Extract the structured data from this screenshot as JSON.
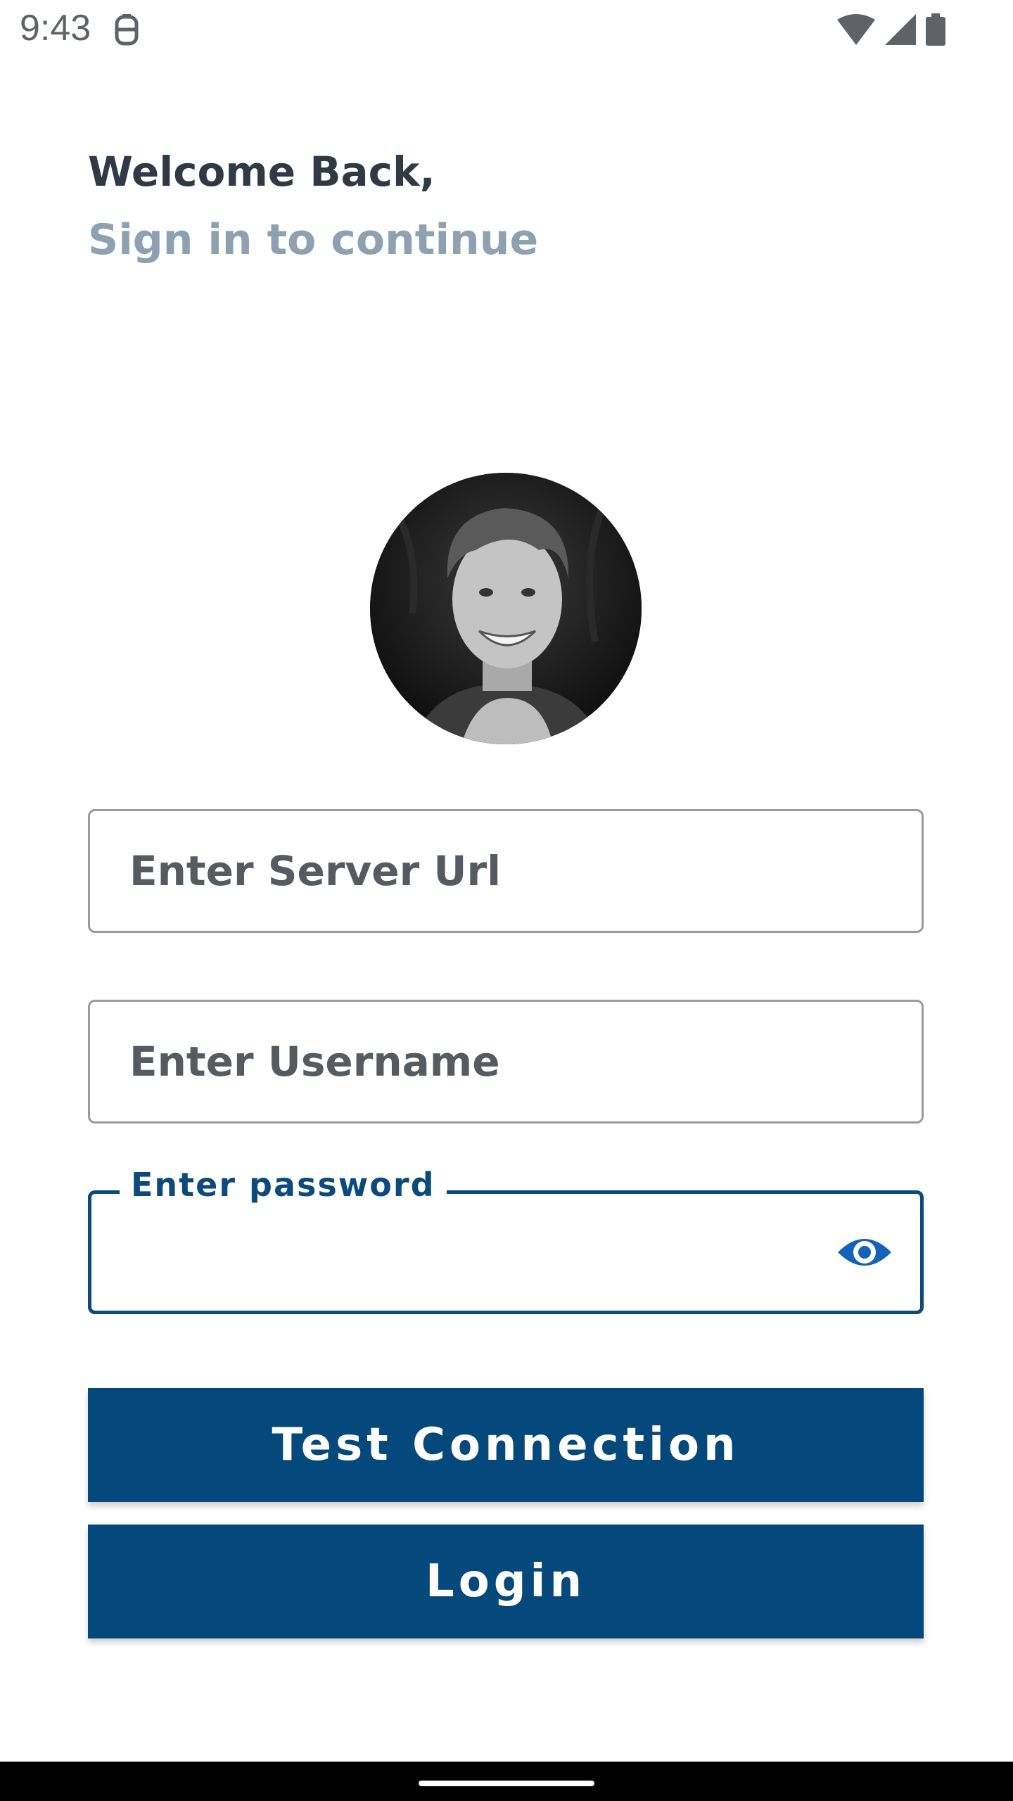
{
  "status_bar": {
    "time": "9:43",
    "icons": [
      "app-notification-icon",
      "wifi-icon",
      "cellular-signal-icon",
      "battery-icon"
    ]
  },
  "header": {
    "welcome": "Welcome Back,",
    "subtitle": "Sign in to continue"
  },
  "avatar": {
    "icon": "profile-photo"
  },
  "form": {
    "server_url": {
      "placeholder": "Enter Server Url",
      "value": ""
    },
    "username": {
      "placeholder": "Enter Username",
      "value": ""
    },
    "password": {
      "label": "Enter password",
      "value": "",
      "toggle_icon": "eye-icon"
    }
  },
  "buttons": {
    "test_connection": "Test Connection",
    "login": "Login"
  },
  "colors": {
    "primary": "#04487c",
    "title": "#2f3a44",
    "subtitle": "#8ea1b0",
    "field_border": "#9a9a9a"
  }
}
